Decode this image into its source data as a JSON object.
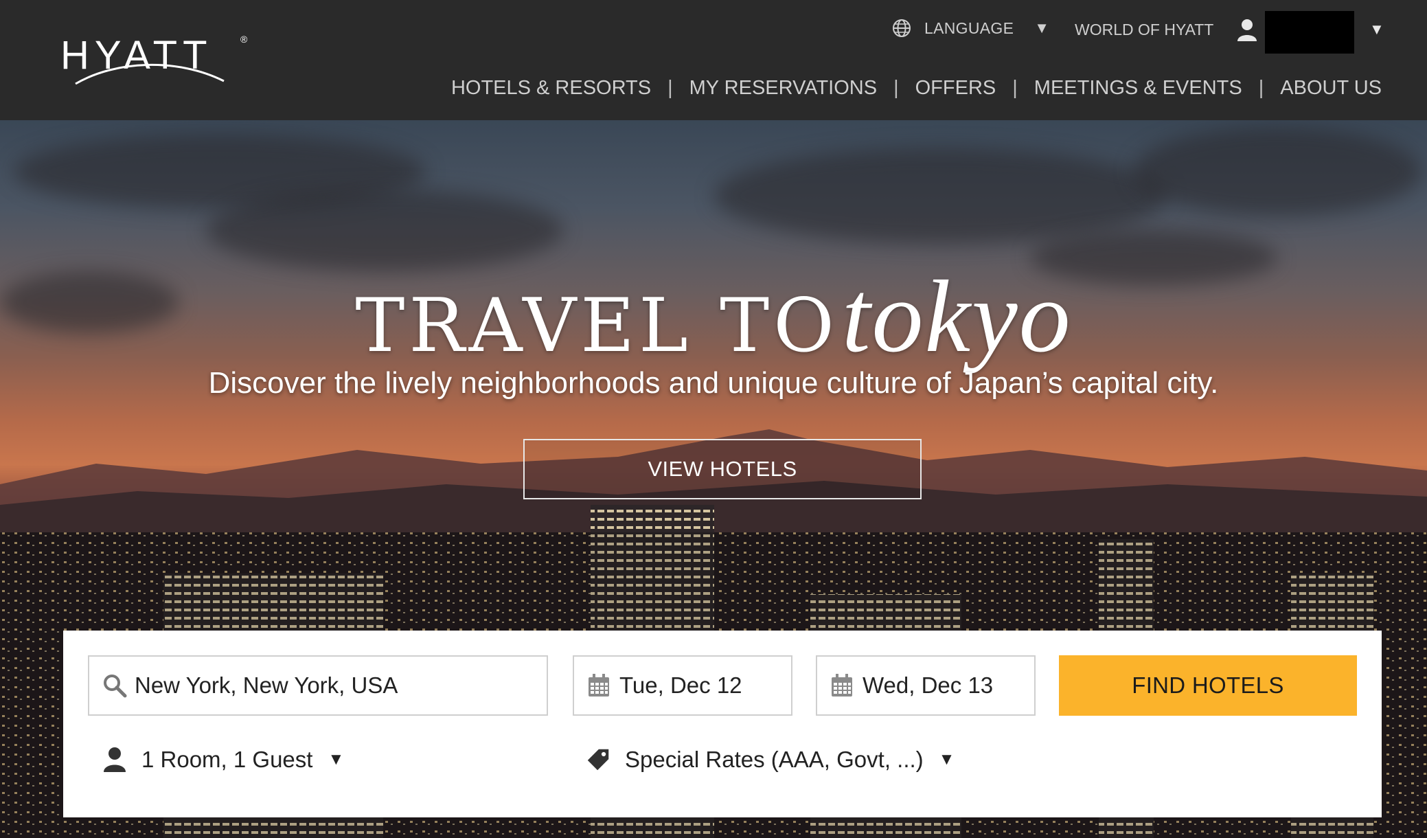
{
  "brand": {
    "logo_text": "HYATT"
  },
  "utility_nav": {
    "language_label": "LANGUAGE",
    "world_label": "WORLD OF HYATT"
  },
  "main_nav": {
    "items": [
      "HOTELS & RESORTS",
      "MY RESERVATIONS",
      "OFFERS",
      "MEETINGS & EVENTS",
      "ABOUT US"
    ],
    "separator": "|"
  },
  "hero": {
    "title_prefix": "TRAVEL TO",
    "title_emphasis": "tokyo",
    "subtitle": "Discover the lively neighborhoods and unique culture of Japan’s capital city.",
    "cta_label": "VIEW HOTELS"
  },
  "search": {
    "location_value": "New York, New York, USA",
    "checkin_value": "Tue, Dec 12",
    "checkout_value": "Wed, Dec 13",
    "submit_label": "FIND HOTELS",
    "rooms_guests_label": "1 Room, 1 Guest",
    "special_rates_label": "Special Rates (AAA, Govt, ...)"
  },
  "icons": {
    "language": "globe-icon",
    "account": "user-icon",
    "dropdown": "caret-down-icon",
    "location": "search-icon",
    "date": "calendar-icon",
    "rates": "tag-icon"
  },
  "colors": {
    "header_bg": "#2a2a2a",
    "accent_button": "#fbb32b",
    "nav_text": "#cfcfcf",
    "panel_bg": "#ffffff"
  }
}
